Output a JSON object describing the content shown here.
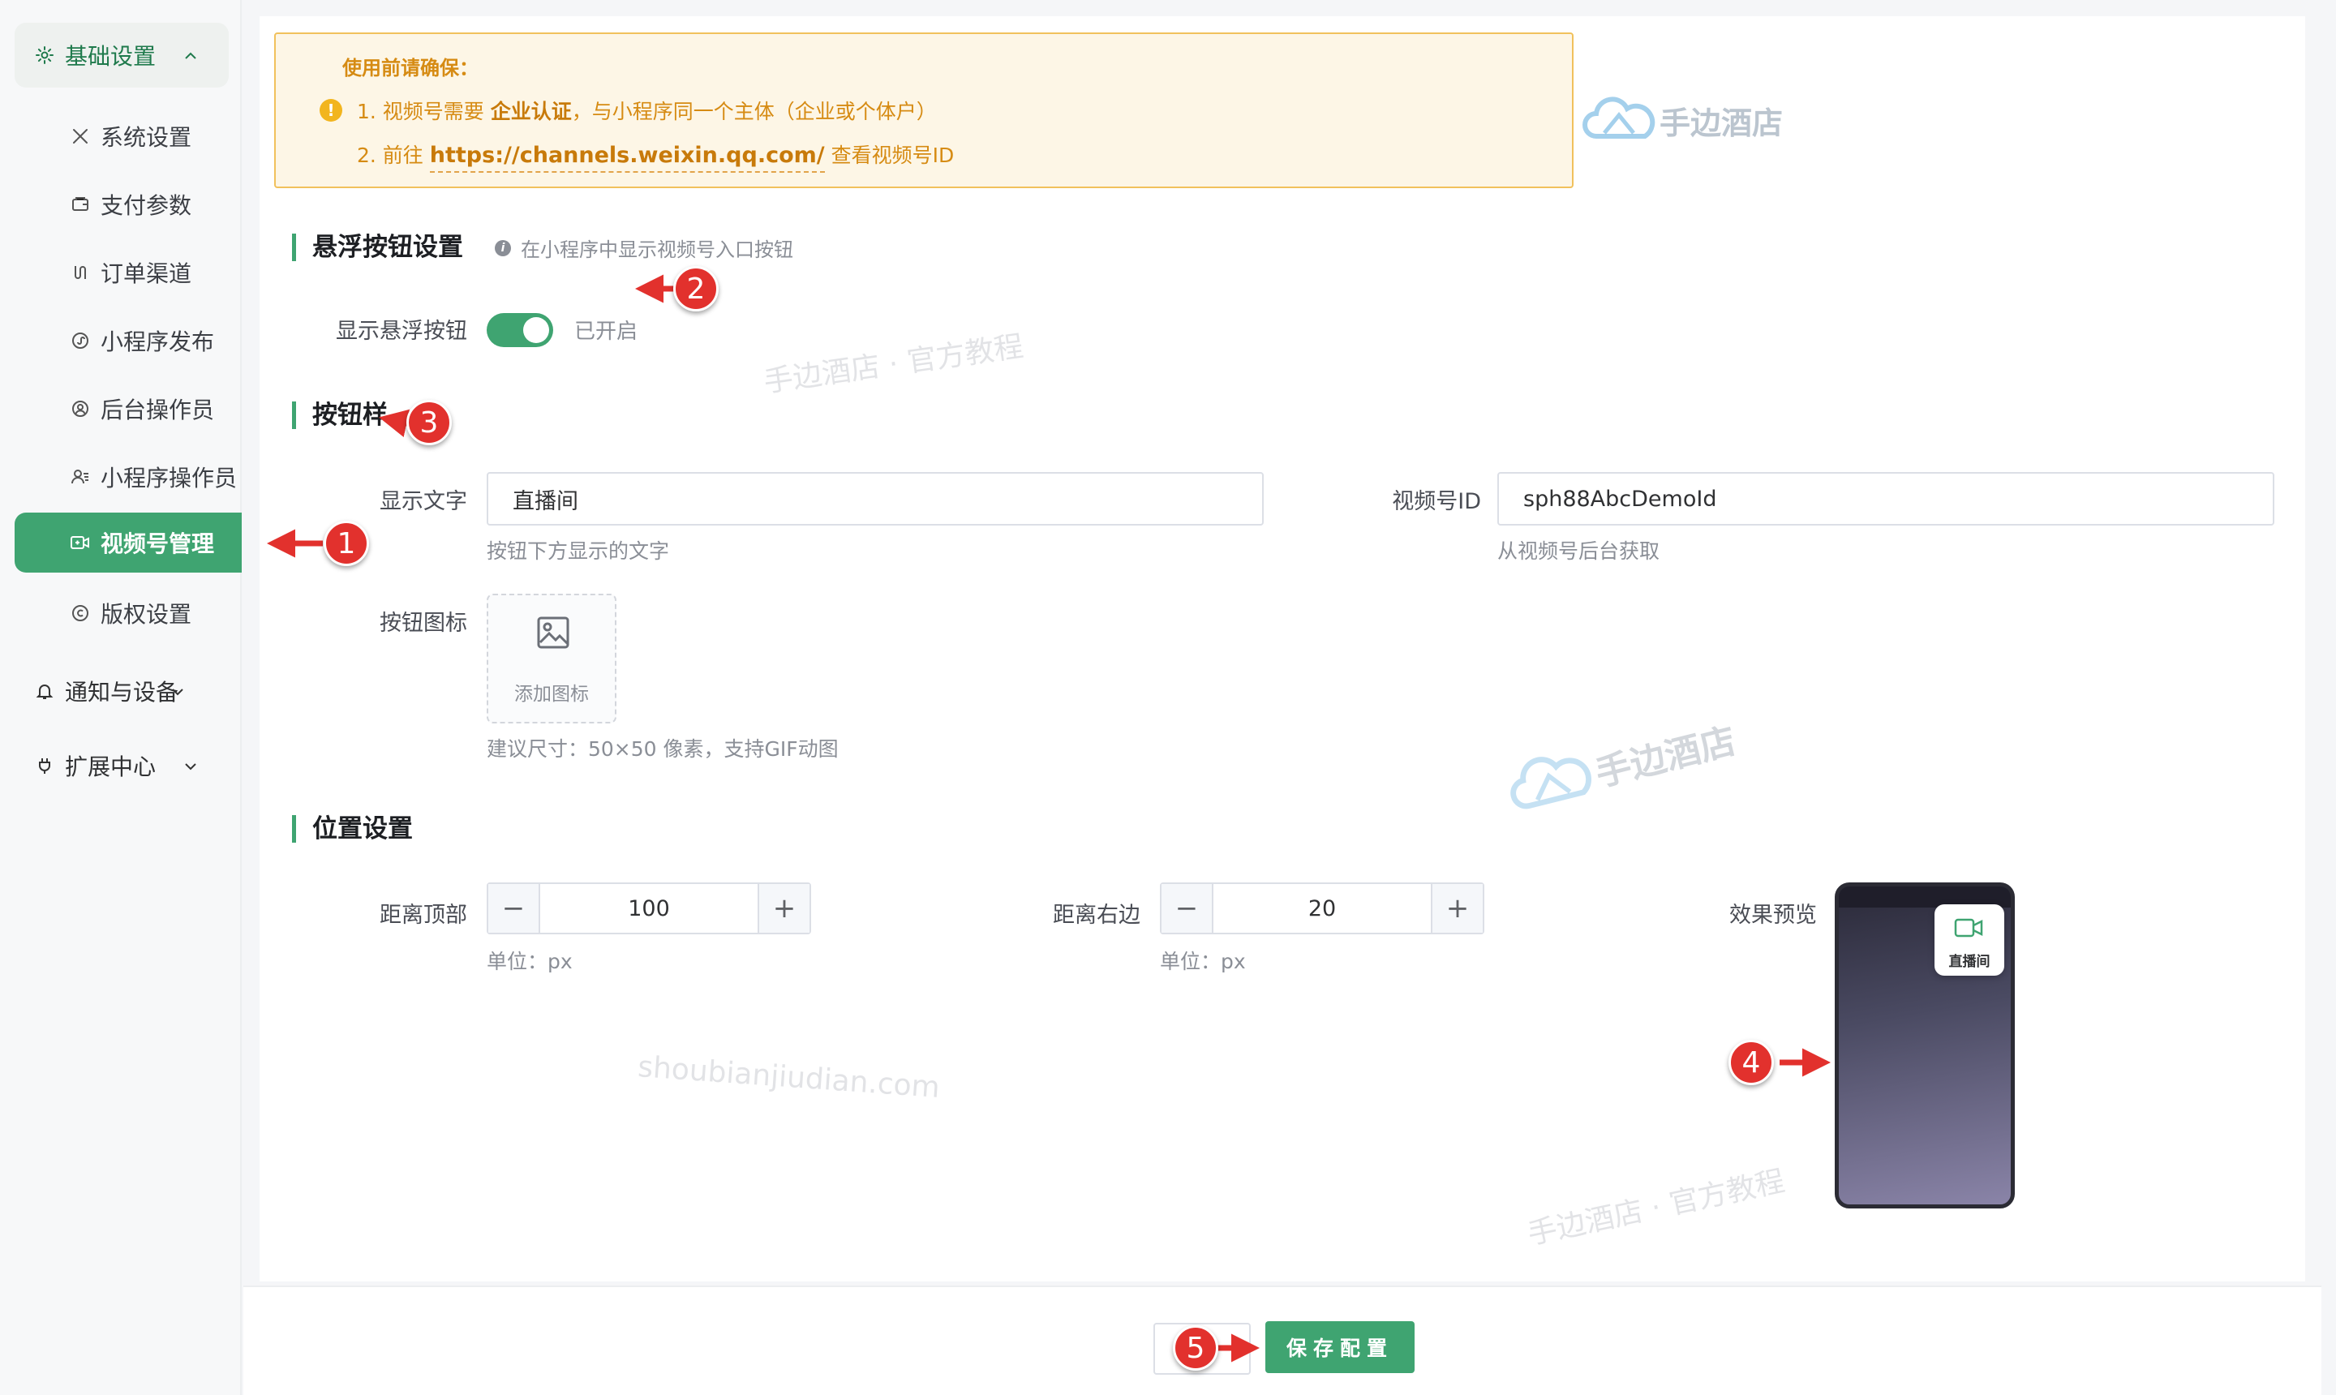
{
  "sidebar": {
    "groups": [
      {
        "label": "基础设置",
        "icon": "gear-icon"
      },
      {
        "label": "通知与设备",
        "icon": "bell-icon"
      },
      {
        "label": "扩展中心",
        "icon": "plug-icon"
      }
    ],
    "items": [
      {
        "label": "系统设置",
        "icon": "tools-icon"
      },
      {
        "label": "支付参数",
        "icon": "wallet-icon"
      },
      {
        "label": "订单渠道",
        "icon": "channel-icon"
      },
      {
        "label": "小程序发布",
        "icon": "miniprogram-icon"
      },
      {
        "label": "后台操作员",
        "icon": "user-circle-icon"
      },
      {
        "label": "小程序操作员",
        "icon": "users-icon"
      },
      {
        "label": "视频号管理",
        "icon": "video-icon"
      },
      {
        "label": "版权设置",
        "icon": "copyright-icon"
      }
    ]
  },
  "notice": {
    "title": "使用前请确保：",
    "line1_prefix": "1. 视频号需要",
    "line1_bold": "企业认证",
    "line1_suffix": "，与小程序同一个主体（企业或个体户）",
    "line2_prefix": "2. 前往",
    "line2_link": "https://channels.weixin.qq.com/",
    "line2_suffix": "查看视频号ID"
  },
  "floating": {
    "title": "悬浮按钮设置",
    "hint": "在小程序中显示视频号入口按钮",
    "toggle_label": "显示悬浮按钮",
    "toggle_state": "已开启"
  },
  "style": {
    "title": "按钮样",
    "text_label": "显示文字",
    "text_value": "直播间",
    "text_hint": "按钮下方显示的文字",
    "id_label": "视频号ID",
    "id_value": "sph88AbcDemoId",
    "id_hint": "从视频号后台获取",
    "icon_label": "按钮图标",
    "upload_text": "添加图标",
    "icon_hint": "建议尺寸：50×50 像素，支持GIF动图"
  },
  "position": {
    "title": "位置设置",
    "top_label": "距离顶部",
    "top_value": "100",
    "top_unit": "单位：px",
    "right_label": "距离右边",
    "right_value": "20",
    "right_unit": "单位：px",
    "preview_label": "效果预览",
    "preview_button_text": "直播间"
  },
  "footer": {
    "save_label": "保存配置"
  },
  "watermarks": {
    "logo_text": "手边酒店",
    "text1": "手边酒店 · 官方教程",
    "text2": "shoubianjiudian.com"
  },
  "markers": [
    "1",
    "2",
    "3",
    "4",
    "5"
  ],
  "colors": {
    "accent": "#3fa471",
    "warning": "#d68b13",
    "marker": "#e2312d"
  }
}
